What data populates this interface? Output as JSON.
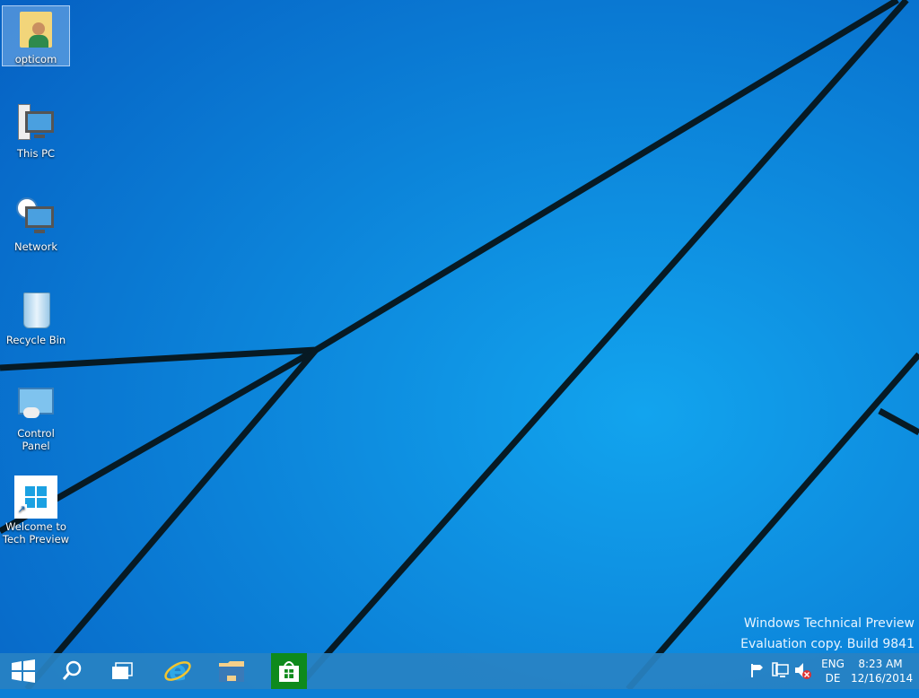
{
  "desktop_icons": [
    {
      "label": "opticom",
      "icon": "user-folder-icon"
    },
    {
      "label": "This PC",
      "icon": "computer-icon"
    },
    {
      "label": "Network",
      "icon": "network-icon"
    },
    {
      "label": "Recycle Bin",
      "icon": "recycle-bin-icon"
    },
    {
      "label": "Control Panel",
      "icon": "control-panel-icon"
    },
    {
      "label": "Welcome to Tech Preview",
      "icon": "windows-shortcut-icon"
    }
  ],
  "watermark": {
    "line1": "Windows Technical Preview",
    "line2": "Evaluation copy. Build 9841"
  },
  "taskbar": {
    "apps": [
      "start-icon",
      "search-icon",
      "task-view-icon",
      "internet-explorer-icon",
      "file-explorer-icon",
      "store-icon"
    ],
    "tray": {
      "lang_top": "ENG",
      "lang_bottom": "DE",
      "time": "8:23 AM",
      "date": "12/16/2014"
    }
  },
  "colors": {
    "accent": "#0a7fd6",
    "taskbar": "#2882c3"
  }
}
